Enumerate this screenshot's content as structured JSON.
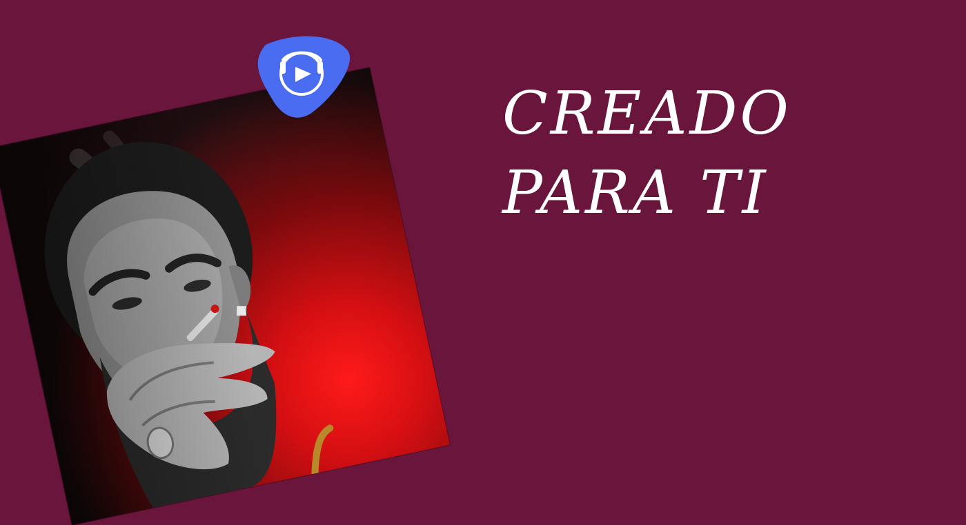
{
  "headline": {
    "line1": "CREADO",
    "line2": "PARA TI"
  },
  "cover": {
    "badge_icon": "music-play-logo-icon",
    "accent_color": "#4a6cf0"
  },
  "colors": {
    "background": "#6a153c",
    "text": "#ffffff",
    "glow": "#ff1a1a"
  }
}
